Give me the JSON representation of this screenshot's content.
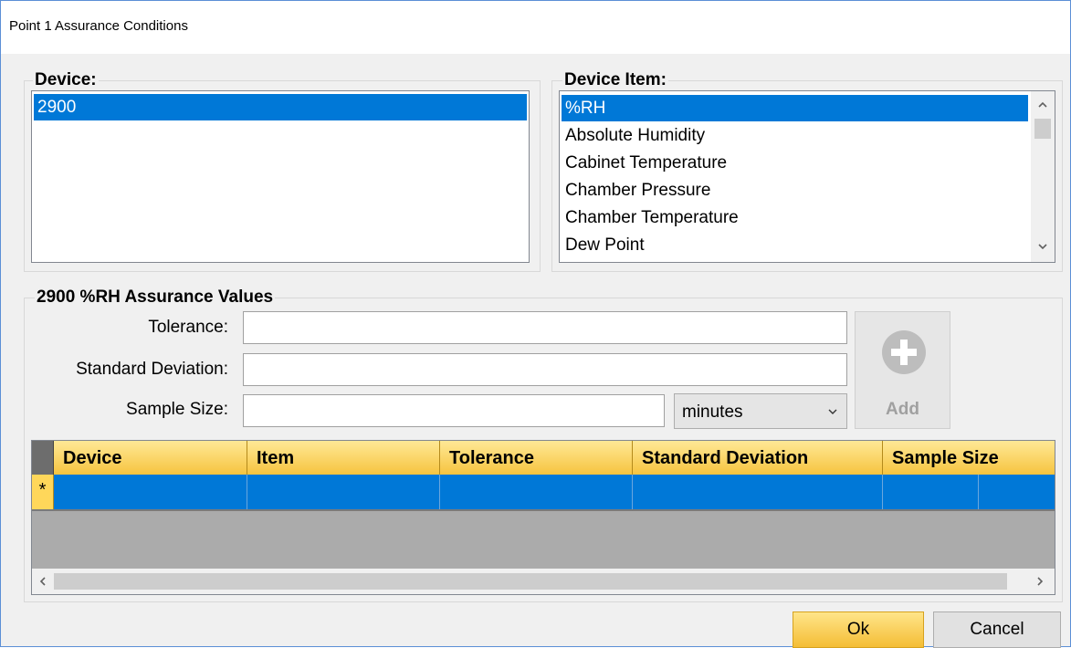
{
  "window": {
    "title": "Point 1 Assurance Conditions"
  },
  "device_group": {
    "label": "Device:",
    "items": [
      {
        "label": "2900",
        "selected": true
      }
    ]
  },
  "device_item_group": {
    "label": "Device Item:",
    "items": [
      {
        "label": "%RH",
        "selected": true
      },
      {
        "label": "Absolute Humidity"
      },
      {
        "label": "Cabinet Temperature"
      },
      {
        "label": "Chamber Pressure"
      },
      {
        "label": "Chamber Temperature"
      },
      {
        "label": "Dew Point"
      }
    ]
  },
  "assurance": {
    "label": "2900 %RH Assurance Values",
    "tolerance_label": "Tolerance:",
    "tolerance_value": "",
    "std_dev_label": "Standard Deviation:",
    "std_dev_value": "",
    "sample_size_label": "Sample Size:",
    "sample_size_value": "",
    "unit_selected": "minutes",
    "add_label": "Add"
  },
  "grid": {
    "columns": [
      "Device",
      "Item",
      "Tolerance",
      "Standard Deviation",
      "Sample Size"
    ],
    "new_row_marker": "*",
    "header_color": "#f6c43f",
    "selection_color": "#0078d7"
  },
  "footer": {
    "ok_label": "Ok",
    "cancel_label": "Cancel"
  }
}
